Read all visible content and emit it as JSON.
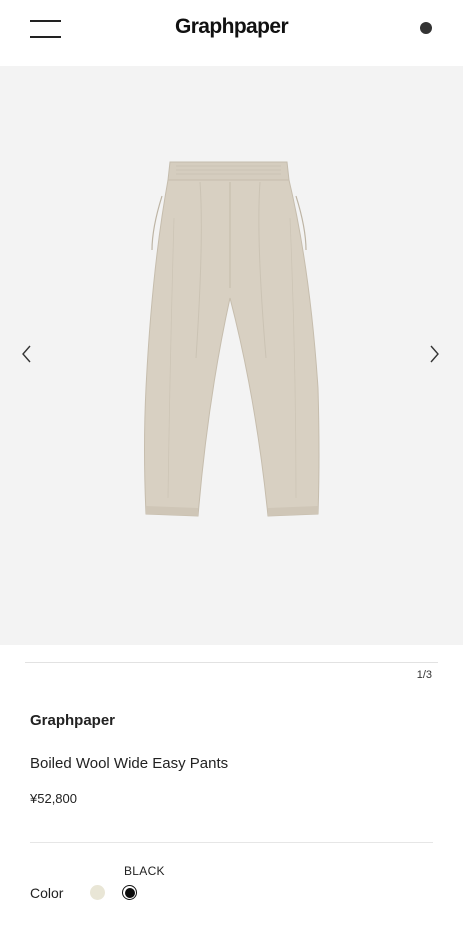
{
  "header": {
    "logo": "Graphpaper",
    "menu_icon": "hamburger-icon",
    "account_icon": "account-dot-icon"
  },
  "gallery": {
    "counter": "1/3",
    "prev_icon": "chevron-left-icon",
    "next_icon": "chevron-right-icon",
    "image": "beige-wide-pants"
  },
  "product": {
    "brand": "Graphpaper",
    "name": "Boiled Wool Wide Easy Pants",
    "price": "¥52,800"
  },
  "color": {
    "label": "Color",
    "selected": "BLACK",
    "options": [
      {
        "name": "beige",
        "hex": "#e9e6d6"
      },
      {
        "name": "black",
        "hex": "#0b0b0b"
      }
    ]
  },
  "colors": {
    "gallery_bg": "#f3f3f3",
    "pants": "#d8d0c2"
  }
}
